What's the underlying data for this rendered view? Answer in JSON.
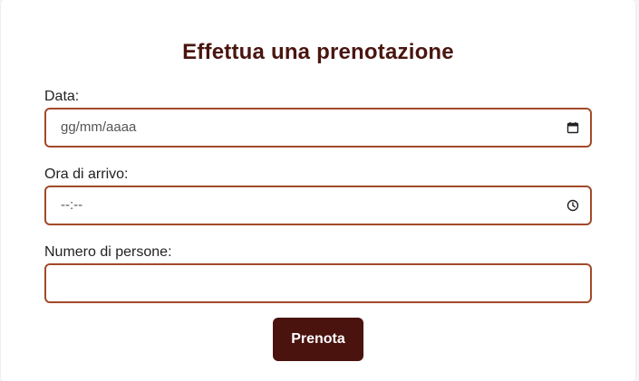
{
  "form": {
    "title": "Effettua una prenotazione",
    "date": {
      "label": "Data:",
      "placeholder": "gg/mm/aaaa",
      "icon": "calendar-icon"
    },
    "time": {
      "label": "Ora di arrivo:",
      "placeholder": "--:--",
      "icon": "clock-icon"
    },
    "people": {
      "label": "Numero di persone:",
      "value": ""
    },
    "submit_label": "Prenota"
  },
  "colors": {
    "title": "#4a1510",
    "field_border": "#a24a2a",
    "button_bg": "#4a130e",
    "button_text": "#ffffff"
  }
}
